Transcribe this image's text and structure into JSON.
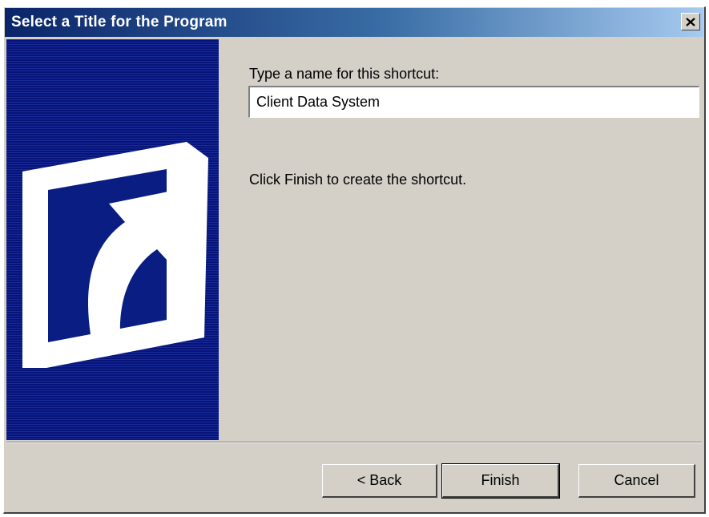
{
  "window": {
    "title": "Select a Title for the Program",
    "close_glyph": "×"
  },
  "wizard": {
    "name_label": "Type a name for this shortcut:",
    "name_value": "Client Data System",
    "finish_hint": "Click Finish to create the shortcut."
  },
  "buttons": {
    "back_label": "< Back",
    "finish_label": "Finish",
    "cancel_label": "Cancel"
  },
  "colors": {
    "titlebar_start": "#0a246a",
    "titlebar_end": "#a6caf0",
    "panel_blue": "#0a1d82",
    "dialog_face": "#d4d0c8"
  },
  "icons": {
    "side_graphic": "shortcut-arrow-icon",
    "close": "close-icon"
  }
}
